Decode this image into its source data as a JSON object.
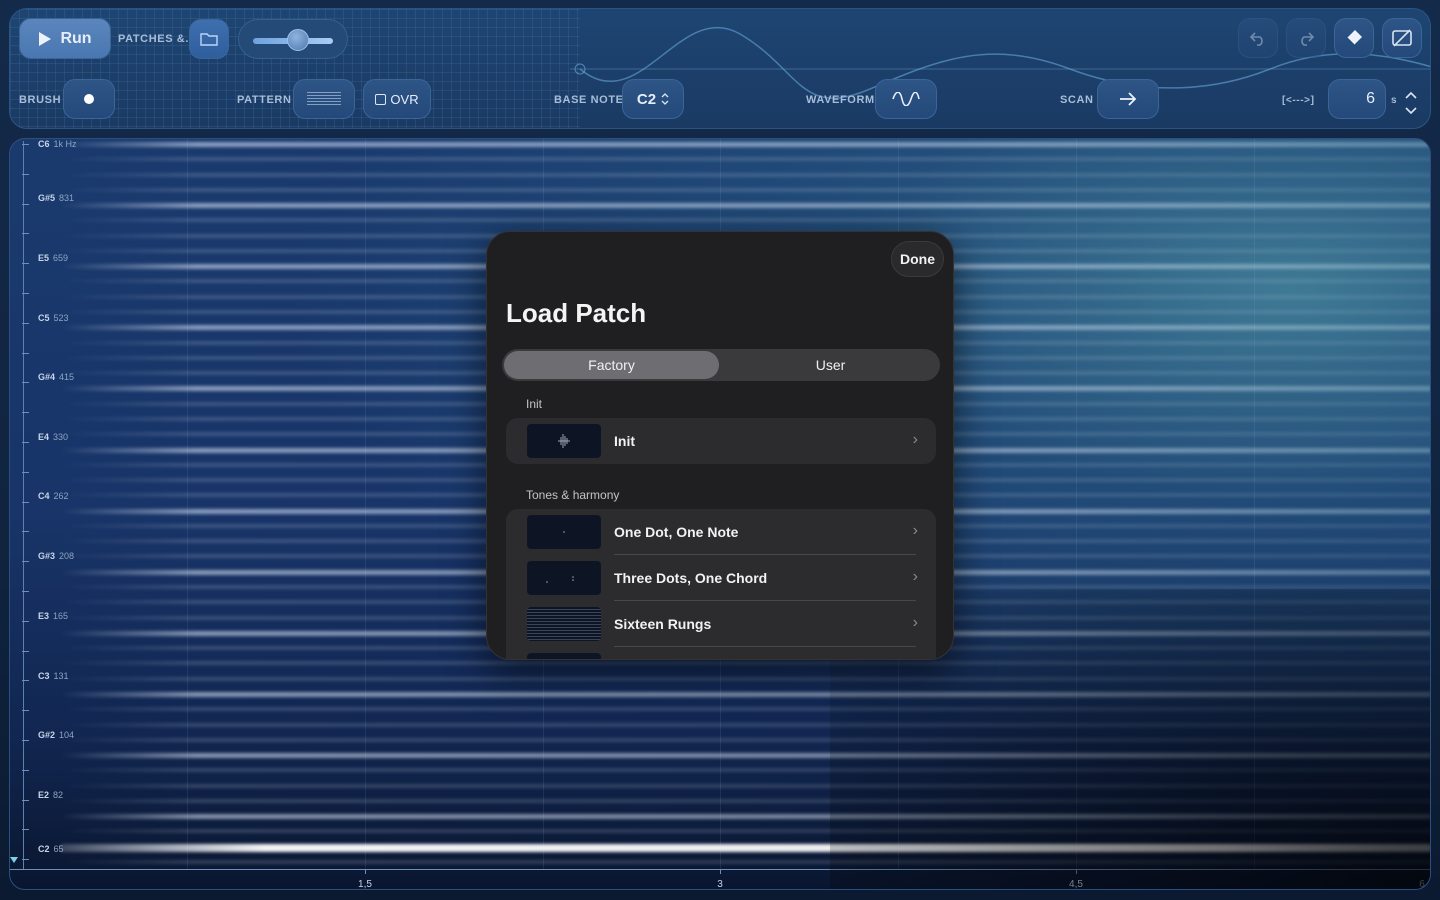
{
  "toolbar": {
    "run_label": "Run",
    "patches_label": "PATCHES &.",
    "brush_label": "BRUSH",
    "pattern_label": "PATTERN",
    "ovr_label": "OVR",
    "base_note_label": "BASE NOTE",
    "base_note_value": "C2",
    "waveform_label": "WAVEFORM",
    "scan_label": "SCAN",
    "range_label": "[<--->]",
    "duration_value": "6",
    "duration_unit": "s",
    "volume_level": 0.55,
    "icons": [
      "play-icon",
      "folder-icon",
      "undo-icon",
      "redo-icon",
      "eraser-icon",
      "hide-overlay-icon",
      "dot-icon",
      "sine-wave-icon",
      "arrow-right-icon",
      "chevron-up-icon",
      "chevron-down-icon"
    ]
  },
  "canvas": {
    "notes": [
      {
        "note": "C6",
        "hz": "1k Hz"
      },
      {
        "note": "G#5",
        "hz": "831"
      },
      {
        "note": "E5",
        "hz": "659"
      },
      {
        "note": "C5",
        "hz": "523"
      },
      {
        "note": "G#4",
        "hz": "415"
      },
      {
        "note": "E4",
        "hz": "330"
      },
      {
        "note": "C4",
        "hz": "262"
      },
      {
        "note": "G#3",
        "hz": "208"
      },
      {
        "note": "E3",
        "hz": "165"
      },
      {
        "note": "C3",
        "hz": "131"
      },
      {
        "note": "G#2",
        "hz": "104"
      },
      {
        "note": "E2",
        "hz": "82"
      },
      {
        "note": "C2",
        "hz": "65"
      }
    ],
    "time_labels": [
      "1,5",
      "3",
      "4,5",
      "6"
    ]
  },
  "modal": {
    "done_label": "Done",
    "title": "Load Patch",
    "tabs": [
      {
        "label": "Factory",
        "active": true
      },
      {
        "label": "User",
        "active": false
      }
    ],
    "sections": [
      {
        "title": "Init",
        "items": [
          {
            "name": "Init"
          }
        ]
      },
      {
        "title": "Tones & harmony",
        "items": [
          {
            "name": "One Dot, One Note"
          },
          {
            "name": "Three Dots, One Chord"
          },
          {
            "name": "Sixteen Rungs"
          }
        ]
      }
    ]
  },
  "colors": {
    "accent": "#4a77b0",
    "panel": "#1f1f21",
    "canvas": "#183468"
  }
}
